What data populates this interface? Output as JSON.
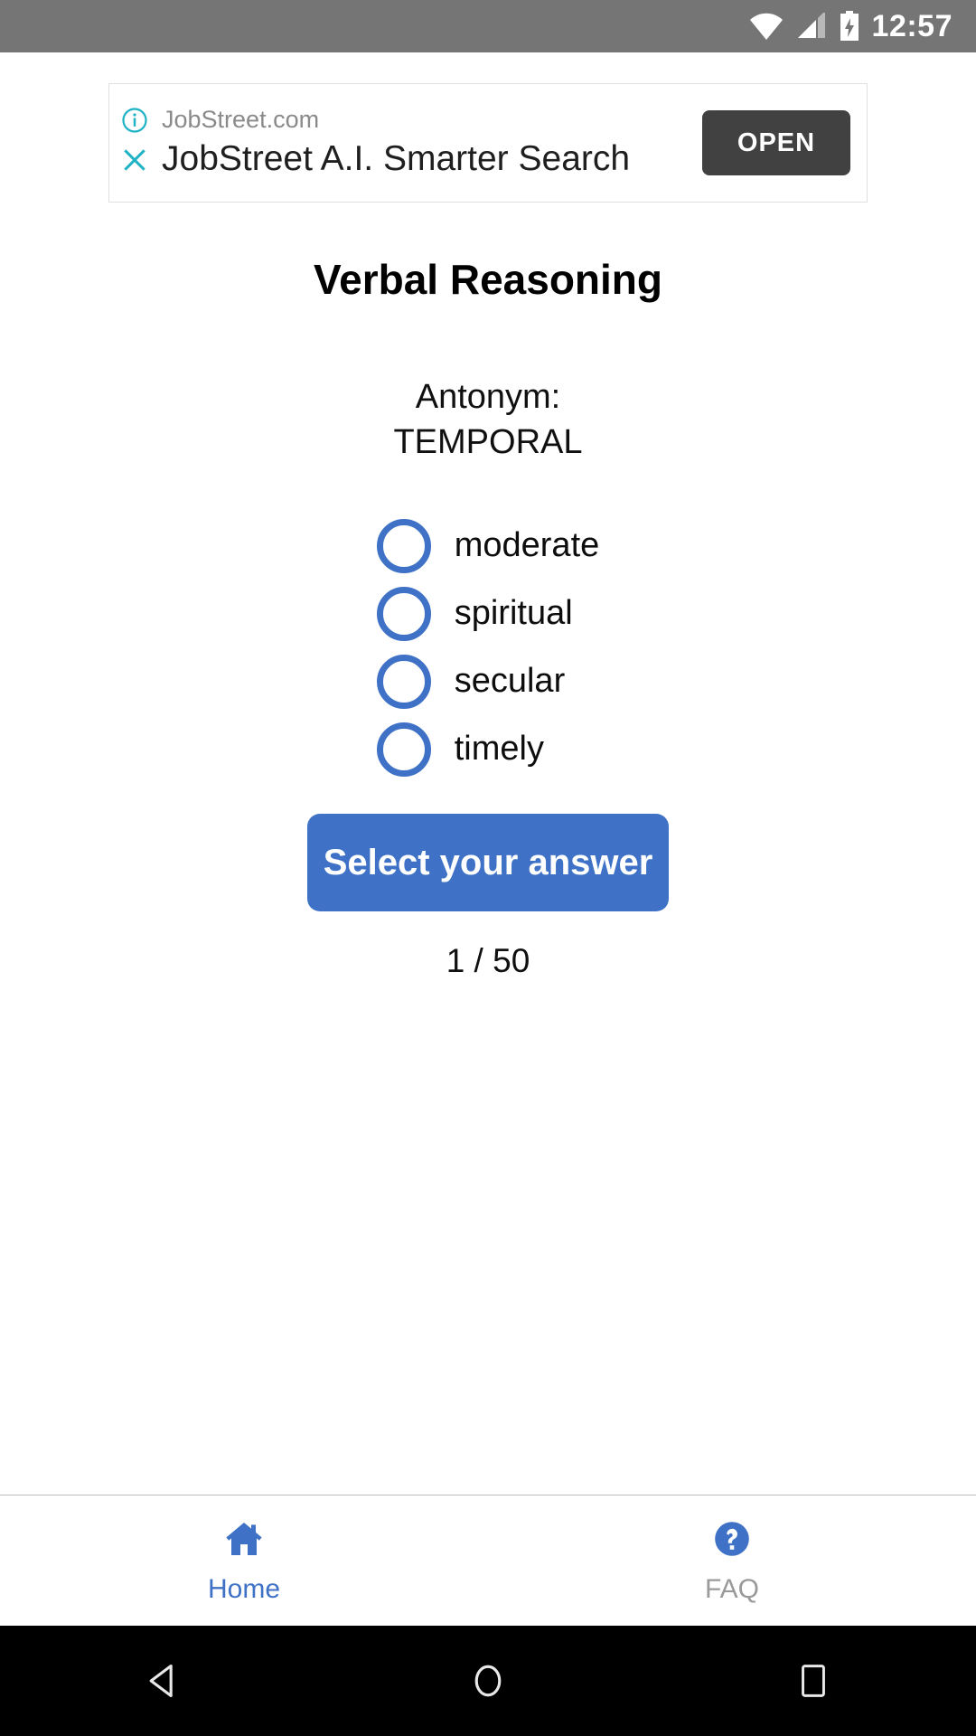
{
  "status_bar": {
    "time": "12:57",
    "icons": [
      "wifi-icon",
      "cell-signal-icon",
      "battery-charging-icon"
    ],
    "background": "#757575"
  },
  "ad": {
    "advertiser": "JobStreet.com",
    "headline": "JobStreet A.I. Smarter Search",
    "cta_label": "OPEN",
    "info_icon": "info-circle-icon",
    "close_icon": "close-icon",
    "badge_color": "#1eb3c4",
    "cta_background": "#414141"
  },
  "main": {
    "title": "Verbal Reasoning",
    "question_prompt": "Antonym:",
    "question_word": "TEMPORAL",
    "options": [
      {
        "label": "moderate",
        "selected": false
      },
      {
        "label": "spiritual",
        "selected": false
      },
      {
        "label": "secular",
        "selected": false
      },
      {
        "label": "timely",
        "selected": false
      }
    ],
    "submit_label": "Select your answer",
    "counter": "1 / 50",
    "accent_color": "#3f72c6"
  },
  "tab_bar": {
    "tabs": [
      {
        "label": "Home",
        "icon": "home-icon",
        "active": true
      },
      {
        "label": "FAQ",
        "icon": "question-circle-icon",
        "active": false
      }
    ]
  },
  "nav_bar": {
    "buttons": [
      {
        "name": "back-icon"
      },
      {
        "name": "home-circle-icon"
      },
      {
        "name": "recents-icon"
      }
    ]
  }
}
